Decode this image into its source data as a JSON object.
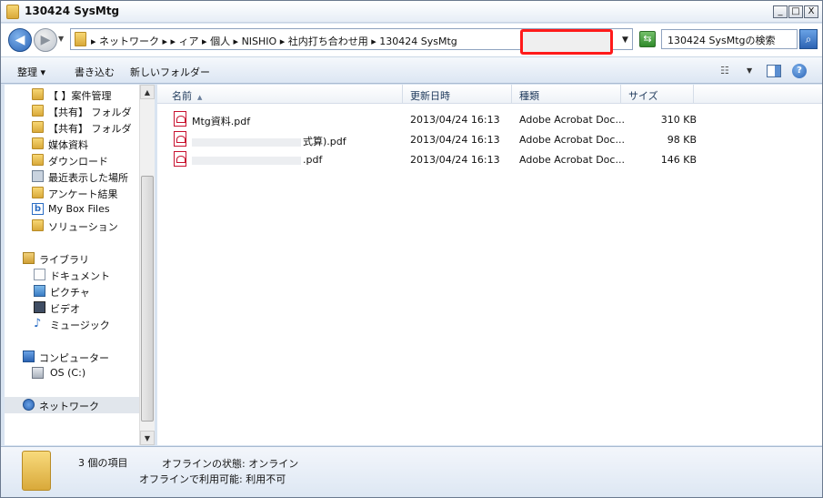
{
  "window": {
    "title": "130424 SysMtg",
    "controls": [
      "_",
      "□",
      "X"
    ]
  },
  "address": {
    "crumbs": "▸ ネットワーク ▸  ▸ ィア ▸ 個人 ▸ NISHIO ▸ 社内打ち合わせ用 ▸ 130424 SysMtg",
    "search_placeholder": "130424 SysMtgの検索"
  },
  "toolbar": {
    "organize": "整理 ▾",
    "burn": "書き込む",
    "new_folder": "新しいフォルダー"
  },
  "nav": {
    "items": [
      {
        "label": "【 】案件管理",
        "icon": "folder-icon"
      },
      {
        "label": "【共有】 フォルダ",
        "icon": "folder-icon"
      },
      {
        "label": "【共有】 フォルダ",
        "icon": "folder-icon"
      },
      {
        "label": "媒体資料",
        "icon": "folder-icon"
      },
      {
        "label": "ダウンロード",
        "icon": "folder-icon"
      },
      {
        "label": "最近表示した場所",
        "icon": "recent-places-icon"
      },
      {
        "label": "アンケート結果",
        "icon": "folder-icon"
      },
      {
        "label": "My Box Files",
        "icon": "box-icon"
      },
      {
        "label": "ソリューション",
        "icon": "folder-icon"
      },
      {
        "label": "ライブラリ",
        "icon": "library-icon"
      },
      {
        "label": "ドキュメント",
        "icon": "documents-icon"
      },
      {
        "label": "ピクチャ",
        "icon": "pictures-icon"
      },
      {
        "label": "ビデオ",
        "icon": "video-icon"
      },
      {
        "label": "ミュージック",
        "icon": "music-icon"
      },
      {
        "label": "コンピューター",
        "icon": "computer-icon"
      },
      {
        "label": "OS (C:)",
        "icon": "drive-icon"
      },
      {
        "label": "ネットワーク",
        "icon": "network-icon"
      }
    ]
  },
  "columns": {
    "name": "名前",
    "date": "更新日時",
    "type": "種類",
    "size": "サイズ"
  },
  "files": [
    {
      "name": "Mtg資料.pdf",
      "date": "2013/04/24 16:13",
      "type": "Adobe Acrobat Doc...",
      "size": "310 KB"
    },
    {
      "name": "式算).pdf",
      "date": "2013/04/24 16:13",
      "type": "Adobe Acrobat Doc...",
      "size": "98 KB"
    },
    {
      "name": ".pdf",
      "date": "2013/04/24 16:13",
      "type": "Adobe Acrobat Doc...",
      "size": "146 KB"
    }
  ],
  "status": {
    "count": "3 個の項目",
    "offline_status": "オフラインの状態: オンライン",
    "offline_available": "オフラインで利用可能: 利用不可"
  }
}
